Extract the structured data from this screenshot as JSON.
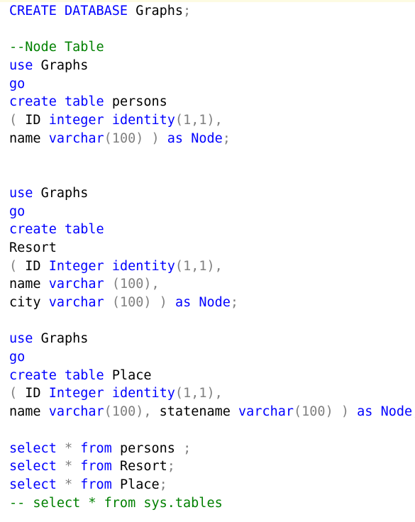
{
  "editor": {
    "language": "sql",
    "colors": {
      "background": "#ffffff",
      "keyword": "#0000ff",
      "identifier": "#000000",
      "comment": "#008000",
      "punctuation": "#808080",
      "number": "#808080",
      "operator": "#808080",
      "top_strip": "#fdfbe2"
    },
    "full_text": "CREATE DATABASE Graphs;\n\n--Node Table\nuse Graphs\ngo\ncreate table persons\n( ID integer identity(1,1),\nname varchar(100) ) as Node;\n\n\nuse Graphs\ngo\ncreate table\nResort\n( ID Integer identity(1,1),\nname varchar (100),\ncity varchar (100) ) as Node;\n\nuse Graphs\ngo\ncreate table Place\n( ID Integer identity(1,1),\nname varchar(100), statename varchar(100) ) as Node;\n\nselect * from persons ;\nselect * from Resort;\nselect * from Place;\n-- select * from sys.tables",
    "lines": [
      {
        "n": 1,
        "tokens": [
          {
            "t": "CREATE",
            "k": "kw"
          },
          {
            "t": " ",
            "k": "id"
          },
          {
            "t": "DATABASE",
            "k": "kw"
          },
          {
            "t": " ",
            "k": "id"
          },
          {
            "t": "Graphs",
            "k": "id"
          },
          {
            "t": ";",
            "k": "punc"
          }
        ]
      },
      {
        "n": 2,
        "tokens": []
      },
      {
        "n": 3,
        "tokens": [
          {
            "t": "--Node Table",
            "k": "com"
          }
        ]
      },
      {
        "n": 4,
        "tokens": [
          {
            "t": "use",
            "k": "kw"
          },
          {
            "t": " ",
            "k": "id"
          },
          {
            "t": "Graphs",
            "k": "id"
          }
        ]
      },
      {
        "n": 5,
        "tokens": [
          {
            "t": "go",
            "k": "kw"
          }
        ]
      },
      {
        "n": 6,
        "tokens": [
          {
            "t": "create",
            "k": "kw"
          },
          {
            "t": " ",
            "k": "id"
          },
          {
            "t": "table",
            "k": "kw"
          },
          {
            "t": " ",
            "k": "id"
          },
          {
            "t": "persons",
            "k": "id"
          }
        ]
      },
      {
        "n": 7,
        "tokens": [
          {
            "t": "(",
            "k": "punc"
          },
          {
            "t": " ",
            "k": "id"
          },
          {
            "t": "ID",
            "k": "id"
          },
          {
            "t": " ",
            "k": "id"
          },
          {
            "t": "integer",
            "k": "kw"
          },
          {
            "t": " ",
            "k": "id"
          },
          {
            "t": "identity",
            "k": "kw"
          },
          {
            "t": "(",
            "k": "punc"
          },
          {
            "t": "1",
            "k": "num"
          },
          {
            "t": ",",
            "k": "punc"
          },
          {
            "t": "1",
            "k": "num"
          },
          {
            "t": "),",
            "k": "punc"
          }
        ]
      },
      {
        "n": 8,
        "tokens": [
          {
            "t": "name",
            "k": "id"
          },
          {
            "t": " ",
            "k": "id"
          },
          {
            "t": "varchar",
            "k": "kw"
          },
          {
            "t": "(",
            "k": "punc"
          },
          {
            "t": "100",
            "k": "num"
          },
          {
            "t": ") ) ",
            "k": "punc"
          },
          {
            "t": "as",
            "k": "kw"
          },
          {
            "t": " ",
            "k": "id"
          },
          {
            "t": "Node",
            "k": "kw"
          },
          {
            "t": ";",
            "k": "punc"
          }
        ]
      },
      {
        "n": 9,
        "tokens": []
      },
      {
        "n": 10,
        "tokens": []
      },
      {
        "n": 11,
        "tokens": [
          {
            "t": "use",
            "k": "kw"
          },
          {
            "t": " ",
            "k": "id"
          },
          {
            "t": "Graphs",
            "k": "id"
          }
        ]
      },
      {
        "n": 12,
        "tokens": [
          {
            "t": "go",
            "k": "kw"
          }
        ]
      },
      {
        "n": 13,
        "tokens": [
          {
            "t": "create",
            "k": "kw"
          },
          {
            "t": " ",
            "k": "id"
          },
          {
            "t": "table",
            "k": "kw"
          }
        ]
      },
      {
        "n": 14,
        "tokens": [
          {
            "t": "Resort",
            "k": "id"
          }
        ]
      },
      {
        "n": 15,
        "tokens": [
          {
            "t": "(",
            "k": "punc"
          },
          {
            "t": " ",
            "k": "id"
          },
          {
            "t": "ID",
            "k": "id"
          },
          {
            "t": " ",
            "k": "id"
          },
          {
            "t": "Integer",
            "k": "kw"
          },
          {
            "t": " ",
            "k": "id"
          },
          {
            "t": "identity",
            "k": "kw"
          },
          {
            "t": "(",
            "k": "punc"
          },
          {
            "t": "1",
            "k": "num"
          },
          {
            "t": ",",
            "k": "punc"
          },
          {
            "t": "1",
            "k": "num"
          },
          {
            "t": "),",
            "k": "punc"
          }
        ]
      },
      {
        "n": 16,
        "tokens": [
          {
            "t": "name",
            "k": "id"
          },
          {
            "t": " ",
            "k": "id"
          },
          {
            "t": "varchar",
            "k": "kw"
          },
          {
            "t": " ",
            "k": "id"
          },
          {
            "t": "(",
            "k": "punc"
          },
          {
            "t": "100",
            "k": "num"
          },
          {
            "t": "),",
            "k": "punc"
          }
        ]
      },
      {
        "n": 17,
        "tokens": [
          {
            "t": "city",
            "k": "id"
          },
          {
            "t": " ",
            "k": "id"
          },
          {
            "t": "varchar",
            "k": "kw"
          },
          {
            "t": " ",
            "k": "id"
          },
          {
            "t": "(",
            "k": "punc"
          },
          {
            "t": "100",
            "k": "num"
          },
          {
            "t": ") ) ",
            "k": "punc"
          },
          {
            "t": "as",
            "k": "kw"
          },
          {
            "t": " ",
            "k": "id"
          },
          {
            "t": "Node",
            "k": "kw"
          },
          {
            "t": ";",
            "k": "punc"
          }
        ]
      },
      {
        "n": 18,
        "tokens": []
      },
      {
        "n": 19,
        "tokens": [
          {
            "t": "use",
            "k": "kw"
          },
          {
            "t": " ",
            "k": "id"
          },
          {
            "t": "Graphs",
            "k": "id"
          }
        ]
      },
      {
        "n": 20,
        "tokens": [
          {
            "t": "go",
            "k": "kw"
          }
        ]
      },
      {
        "n": 21,
        "tokens": [
          {
            "t": "create",
            "k": "kw"
          },
          {
            "t": " ",
            "k": "id"
          },
          {
            "t": "table",
            "k": "kw"
          },
          {
            "t": " ",
            "k": "id"
          },
          {
            "t": "Place",
            "k": "id"
          }
        ]
      },
      {
        "n": 22,
        "tokens": [
          {
            "t": "(",
            "k": "punc"
          },
          {
            "t": " ",
            "k": "id"
          },
          {
            "t": "ID",
            "k": "id"
          },
          {
            "t": " ",
            "k": "id"
          },
          {
            "t": "Integer",
            "k": "kw"
          },
          {
            "t": " ",
            "k": "id"
          },
          {
            "t": "identity",
            "k": "kw"
          },
          {
            "t": "(",
            "k": "punc"
          },
          {
            "t": "1",
            "k": "num"
          },
          {
            "t": ",",
            "k": "punc"
          },
          {
            "t": "1",
            "k": "num"
          },
          {
            "t": "),",
            "k": "punc"
          }
        ]
      },
      {
        "n": 23,
        "tokens": [
          {
            "t": "name",
            "k": "id"
          },
          {
            "t": " ",
            "k": "id"
          },
          {
            "t": "varchar",
            "k": "kw"
          },
          {
            "t": "(",
            "k": "punc"
          },
          {
            "t": "100",
            "k": "num"
          },
          {
            "t": "), ",
            "k": "punc"
          },
          {
            "t": "statename",
            "k": "id"
          },
          {
            "t": " ",
            "k": "id"
          },
          {
            "t": "varchar",
            "k": "kw"
          },
          {
            "t": "(",
            "k": "punc"
          },
          {
            "t": "100",
            "k": "num"
          },
          {
            "t": ") ) ",
            "k": "punc"
          },
          {
            "t": "as",
            "k": "kw"
          },
          {
            "t": " ",
            "k": "id"
          },
          {
            "t": "Node",
            "k": "kw"
          },
          {
            "t": ";",
            "k": "punc"
          }
        ]
      },
      {
        "n": 24,
        "tokens": []
      },
      {
        "n": 25,
        "tokens": [
          {
            "t": "select",
            "k": "kw"
          },
          {
            "t": " ",
            "k": "id"
          },
          {
            "t": "*",
            "k": "op"
          },
          {
            "t": " ",
            "k": "id"
          },
          {
            "t": "from",
            "k": "kw"
          },
          {
            "t": " ",
            "k": "id"
          },
          {
            "t": "persons",
            "k": "id"
          },
          {
            "t": " ",
            "k": "id"
          },
          {
            "t": ";",
            "k": "punc"
          }
        ]
      },
      {
        "n": 26,
        "tokens": [
          {
            "t": "select",
            "k": "kw"
          },
          {
            "t": " ",
            "k": "id"
          },
          {
            "t": "*",
            "k": "op"
          },
          {
            "t": " ",
            "k": "id"
          },
          {
            "t": "from",
            "k": "kw"
          },
          {
            "t": " ",
            "k": "id"
          },
          {
            "t": "Resort",
            "k": "id"
          },
          {
            "t": ";",
            "k": "punc"
          }
        ]
      },
      {
        "n": 27,
        "tokens": [
          {
            "t": "select",
            "k": "kw"
          },
          {
            "t": " ",
            "k": "id"
          },
          {
            "t": "*",
            "k": "op"
          },
          {
            "t": " ",
            "k": "id"
          },
          {
            "t": "from",
            "k": "kw"
          },
          {
            "t": " ",
            "k": "id"
          },
          {
            "t": "Place",
            "k": "id"
          },
          {
            "t": ";",
            "k": "punc"
          }
        ]
      },
      {
        "n": 28,
        "tokens": [
          {
            "t": "-- select * from sys.tables",
            "k": "com"
          }
        ]
      }
    ]
  }
}
